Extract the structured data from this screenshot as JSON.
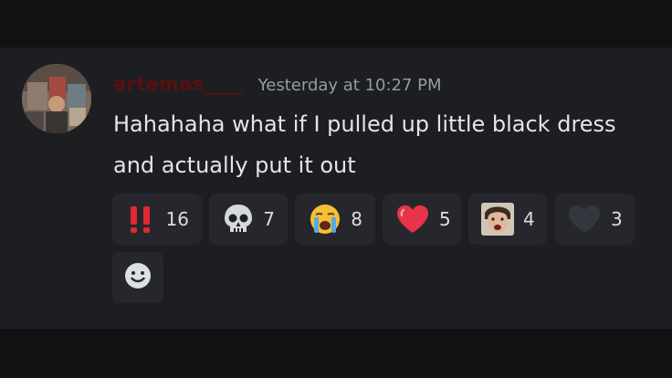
{
  "message": {
    "username": "artemas____",
    "timestamp": "Yesterday at 10:27 PM",
    "content": "Hahahaha what if I pulled up little black dress and actually put it out"
  },
  "reactions": [
    {
      "emoji": "double-exclamation-icon",
      "count": "16"
    },
    {
      "emoji": "skull-icon",
      "count": "7"
    },
    {
      "emoji": "crying-face-icon",
      "count": "8"
    },
    {
      "emoji": "heart-icon",
      "count": "5"
    },
    {
      "emoji": "custom-face-emoji-icon",
      "count": "4"
    },
    {
      "emoji": "dark-heart-icon",
      "count": "3"
    }
  ],
  "add_reaction": {
    "icon": "smiley-icon"
  },
  "colors": {
    "background": "#1d1e22",
    "username": "#5a0f10",
    "timestamp": "#949ba4",
    "text": "#e3e5e8",
    "reaction_bg": "#26272c"
  }
}
